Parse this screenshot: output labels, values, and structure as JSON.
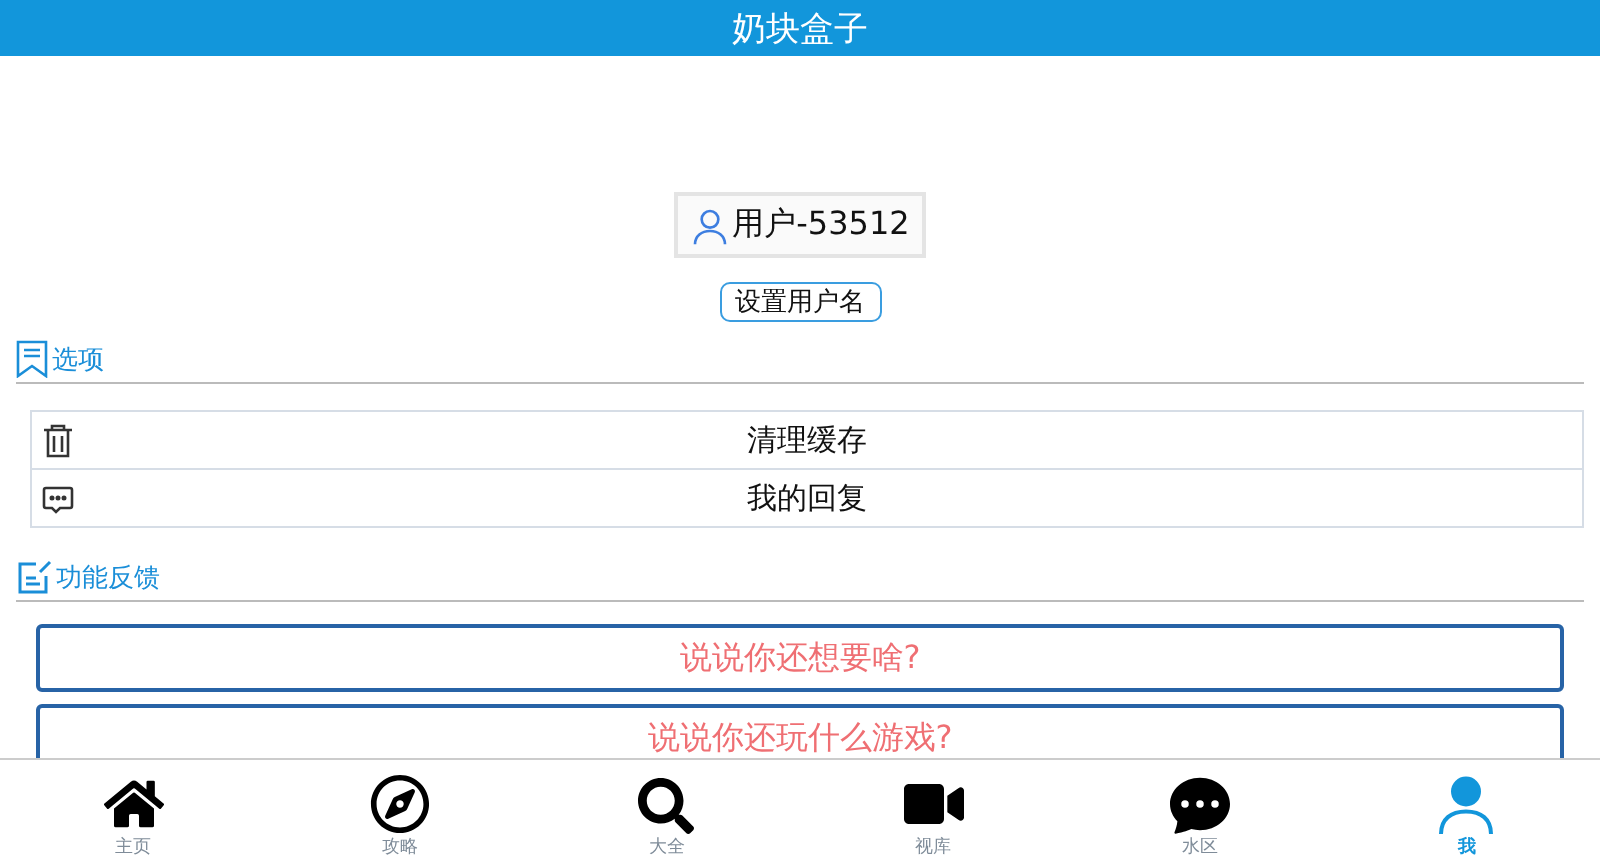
{
  "header": {
    "title": "奶块盒子"
  },
  "user": {
    "name": "用户-53512",
    "button": "设置用户名"
  },
  "options": {
    "title": "选项",
    "items": [
      {
        "label": "清理缓存"
      },
      {
        "label": "我的回复"
      }
    ]
  },
  "feedback": {
    "title": "功能反馈",
    "buttons": [
      "说说你还想要啥?",
      "说说你还玩什么游戏?"
    ]
  },
  "tabs": [
    {
      "label": "主页",
      "selected": false
    },
    {
      "label": "攻略",
      "selected": false
    },
    {
      "label": "大全",
      "selected": false
    },
    {
      "label": "视库",
      "selected": false
    },
    {
      "label": "水区",
      "selected": false
    },
    {
      "label": "我",
      "selected": true
    }
  ]
}
